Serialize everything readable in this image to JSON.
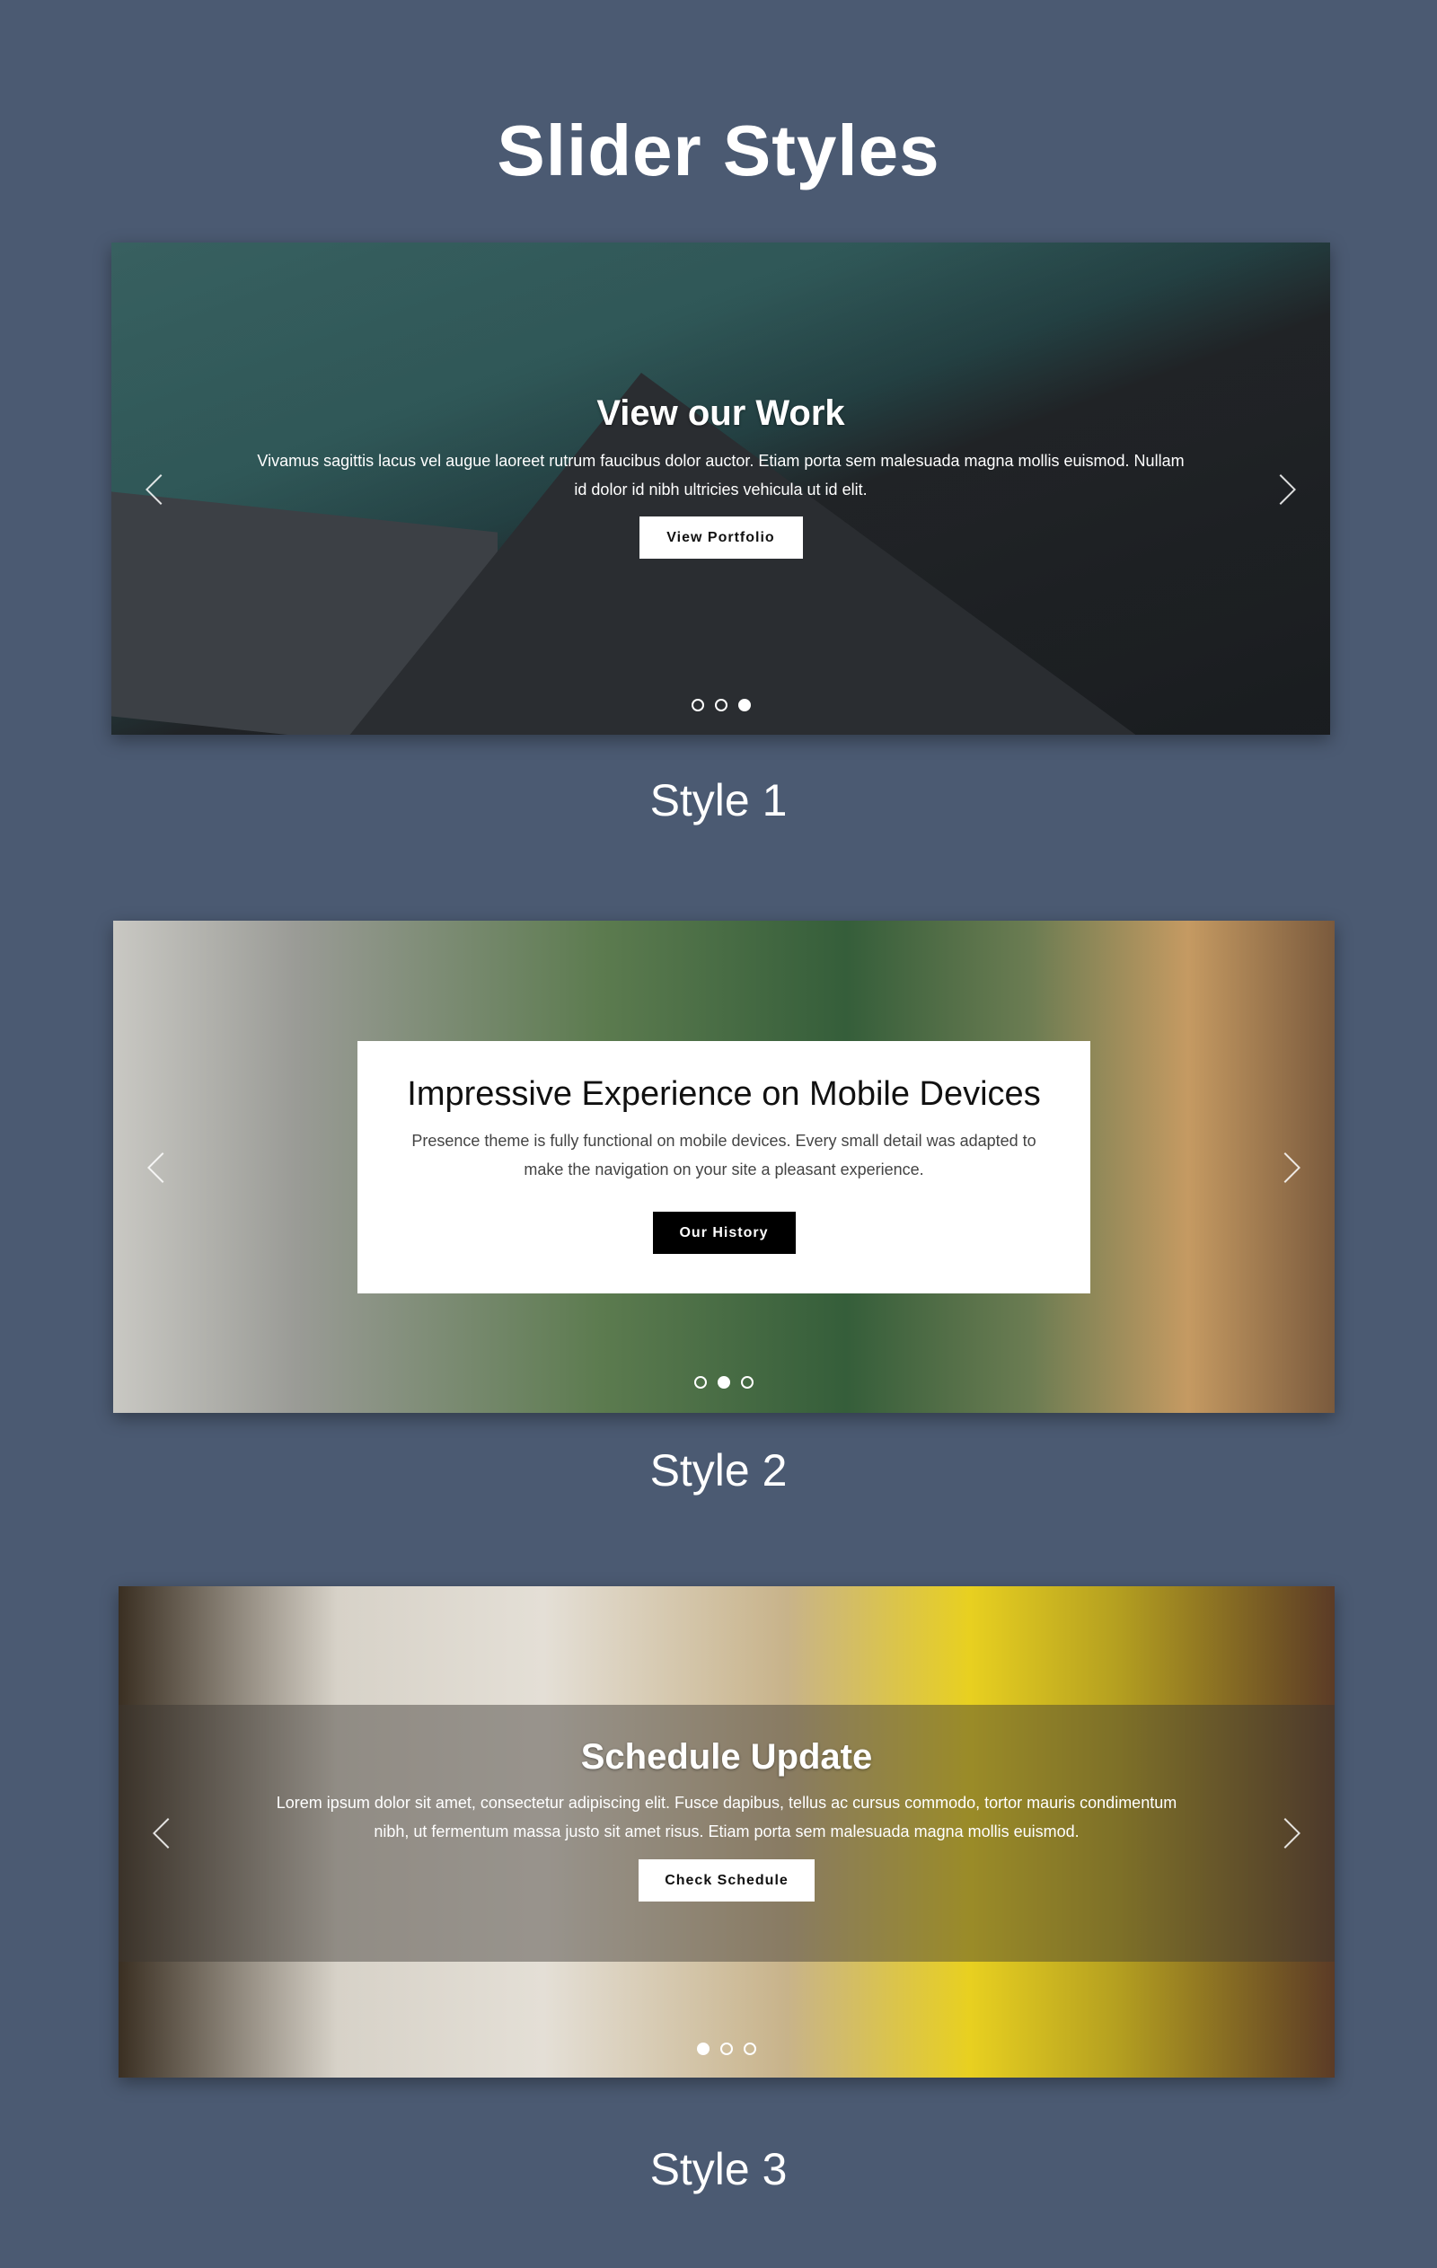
{
  "page": {
    "title": "Slider Styles"
  },
  "sliders": [
    {
      "title": "View our Work",
      "text_line1": "Vivamus sagittis lacus vel augue laoreet rutrum faucibus dolor auctor. Etiam porta sem malesuada magna mollis euismod. Nullam",
      "text_line2": "id dolor id nibh ultricies vehicula ut id elit.",
      "button": "View Portfolio",
      "active_dot": 3,
      "dot_count": 3,
      "label": "Style 1"
    },
    {
      "title": "Impressive Experience on Mobile Devices",
      "text_line1": "Presence theme is fully functional on mobile devices. Every small detail was adapted to",
      "text_line2": "make the navigation on your site a pleasant experience.",
      "button": "Our History",
      "active_dot": 2,
      "dot_count": 3,
      "label": "Style 2"
    },
    {
      "title": "Schedule Update",
      "text_line1": "Lorem ipsum dolor sit amet, consectetur adipiscing elit. Fusce dapibus, tellus ac cursus commodo, tortor mauris condimentum",
      "text_line2": "nibh, ut fermentum massa justo sit amet risus. Etiam porta sem malesuada magna mollis euismod.",
      "button": "Check Schedule",
      "active_dot": 1,
      "dot_count": 3,
      "label": "Style 3"
    }
  ],
  "icons": {
    "prev": "chevron-left-icon",
    "next": "chevron-right-icon"
  },
  "colors": {
    "background": "#4b5a72",
    "button_light": "#ffffff",
    "button_dark": "#000000"
  }
}
